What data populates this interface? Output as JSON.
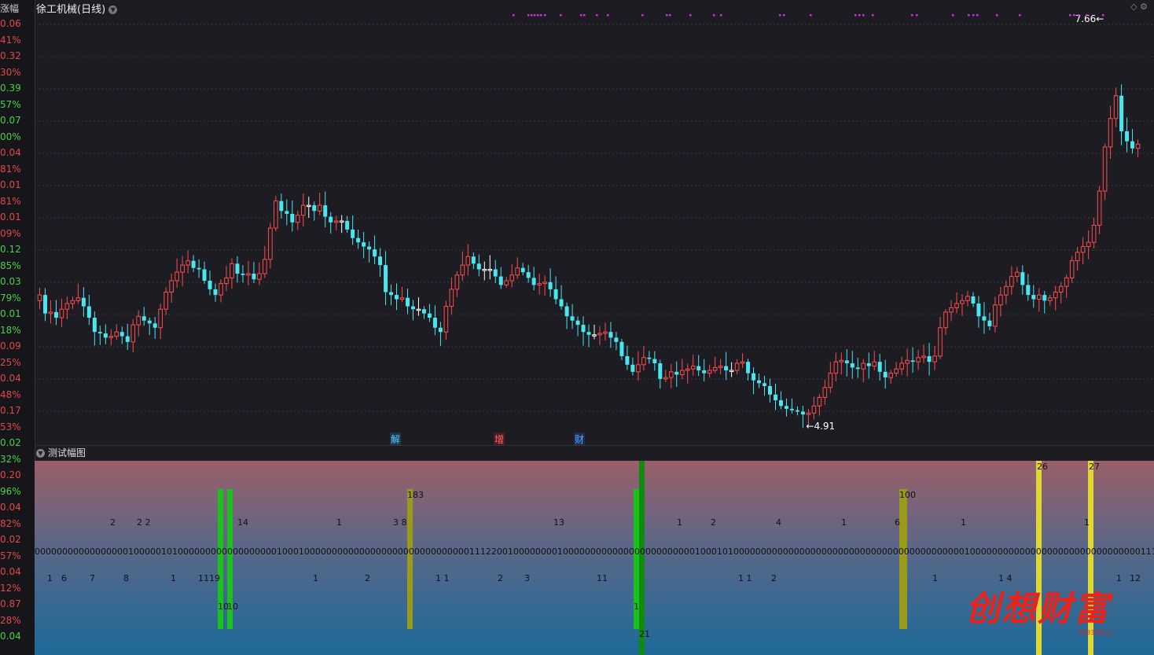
{
  "window": {
    "title": "徐工机械(日线)",
    "menu_icon": "chevron-down-icon"
  },
  "axis": {
    "header": "涨幅",
    "labels": [
      [
        "0.06",
        "#e04a4a"
      ],
      [
        "41%",
        "#e04a4a"
      ],
      [
        "0.32",
        "#e04a4a"
      ],
      [
        "30%",
        "#e04a4a"
      ],
      [
        "0.39",
        "#4ad04a"
      ],
      [
        "57%",
        "#4ad04a"
      ],
      [
        "0.07",
        "#4ad04a"
      ],
      [
        "00%",
        "#4ad04a"
      ],
      [
        "0.04",
        "#e04a4a"
      ],
      [
        "81%",
        "#e04a4a"
      ],
      [
        "0.01",
        "#e04a4a"
      ],
      [
        "81%",
        "#e04a4a"
      ],
      [
        "0.01",
        "#e04a4a"
      ],
      [
        "09%",
        "#e04a4a"
      ],
      [
        "0.12",
        "#4ad04a"
      ],
      [
        "85%",
        "#4ad04a"
      ],
      [
        "0.03",
        "#4ad04a"
      ],
      [
        "79%",
        "#4ad04a"
      ],
      [
        "0.01",
        "#4ad04a"
      ],
      [
        "18%",
        "#4ad04a"
      ],
      [
        "0.09",
        "#e04a4a"
      ],
      [
        "25%",
        "#e04a4a"
      ],
      [
        "0.04",
        "#e04a4a"
      ],
      [
        "48%",
        "#e04a4a"
      ],
      [
        "0.17",
        "#e04a4a"
      ],
      [
        "53%",
        "#e04a4a"
      ],
      [
        "0.02",
        "#4ad04a"
      ],
      [
        "32%",
        "#4ad04a"
      ],
      [
        "0.20",
        "#e04a4a"
      ],
      [
        "96%",
        "#4ad04a"
      ],
      [
        "0.04",
        "#e04a4a"
      ],
      [
        "82%",
        "#e04a4a"
      ],
      [
        "0.02",
        "#e04a4a"
      ],
      [
        "57%",
        "#e04a4a"
      ],
      [
        "0.04",
        "#e04a4a"
      ],
      [
        "12%",
        "#e04a4a"
      ],
      [
        "0.87",
        "#e04a4a"
      ],
      [
        "28%",
        "#e04a4a"
      ],
      [
        "0.04",
        "#4ad04a"
      ]
    ]
  },
  "price_labels": {
    "high": "7.66",
    "low": "4.91"
  },
  "event_tags": [
    {
      "text": "解",
      "color": "#55c8ff",
      "bg": "#1e3548"
    },
    {
      "text": "增",
      "color": "#ff6a6a",
      "bg": "#4a1e22"
    },
    {
      "text": "财",
      "color": "#55a8ff",
      "bg": "#1e2d48"
    }
  ],
  "sub_panel": {
    "title": "测试幅图"
  },
  "logo": {
    "text": "创想财富",
    "subtext": "993358.cn"
  },
  "colors": {
    "up": "#ff4d4d",
    "down": "#4ae6f0",
    "doji": "#ffffff",
    "marker": "#d030e0"
  },
  "chart_data": {
    "type": "candlestick",
    "high_price": 7.66,
    "low_price": 4.91,
    "closes": [
      5.78,
      5.65,
      5.66,
      5.62,
      5.68,
      5.72,
      5.74,
      5.76,
      5.7,
      5.62,
      5.52,
      5.51,
      5.48,
      5.49,
      5.52,
      5.49,
      5.45,
      5.57,
      5.63,
      5.6,
      5.58,
      5.55,
      5.68,
      5.8,
      5.88,
      5.94,
      5.99,
      6.02,
      5.97,
      5.96,
      5.88,
      5.82,
      5.78,
      5.86,
      5.9,
      6.0,
      5.93,
      5.92,
      5.93,
      5.89,
      5.93,
      6.03,
      6.25,
      6.44,
      6.37,
      6.35,
      6.29,
      6.34,
      6.41,
      6.41,
      6.37,
      6.41,
      6.33,
      6.29,
      6.3,
      6.3,
      6.24,
      6.18,
      6.15,
      6.12,
      6.1,
      6.05,
      5.99,
      5.8,
      5.78,
      5.75,
      5.76,
      5.7,
      5.68,
      5.68,
      5.65,
      5.62,
      5.55,
      5.52,
      5.7,
      5.82,
      5.92,
      5.99,
      6.05,
      6.0,
      5.96,
      5.96,
      5.96,
      5.91,
      5.85,
      5.88,
      5.92,
      5.97,
      5.94,
      5.9,
      5.85,
      5.86,
      5.87,
      5.82,
      5.75,
      5.7,
      5.63,
      5.6,
      5.57,
      5.52,
      5.5,
      5.5,
      5.51,
      5.52,
      5.48,
      5.45,
      5.35,
      5.29,
      5.24,
      5.29,
      5.34,
      5.33,
      5.3,
      5.19,
      5.2,
      5.24,
      5.22,
      5.25,
      5.26,
      5.28,
      5.25,
      5.23,
      5.25,
      5.27,
      5.28,
      5.25,
      5.25,
      5.3,
      5.31,
      5.23,
      5.18,
      5.16,
      5.14,
      5.08,
      5.04,
      5.0,
      4.98,
      4.97,
      4.96,
      4.94,
      4.95,
      5.0,
      5.06,
      5.13,
      5.23,
      5.31,
      5.32,
      5.3,
      5.27,
      5.26,
      5.3,
      5.28,
      5.31,
      5.24,
      5.2,
      5.23,
      5.26,
      5.3,
      5.32,
      5.31,
      5.34,
      5.35,
      5.31,
      5.35,
      5.55,
      5.66,
      5.69,
      5.72,
      5.74,
      5.77,
      5.72,
      5.63,
      5.6,
      5.56,
      5.71,
      5.78,
      5.84,
      5.91,
      5.94,
      5.85,
      5.78,
      5.75,
      5.78,
      5.74,
      5.76,
      5.8,
      5.84,
      5.9,
      6.02,
      6.08,
      6.12,
      6.15,
      6.27,
      6.51,
      6.82,
      7.02,
      7.18,
      6.93,
      6.86,
      6.81,
      6.84
    ]
  }
}
